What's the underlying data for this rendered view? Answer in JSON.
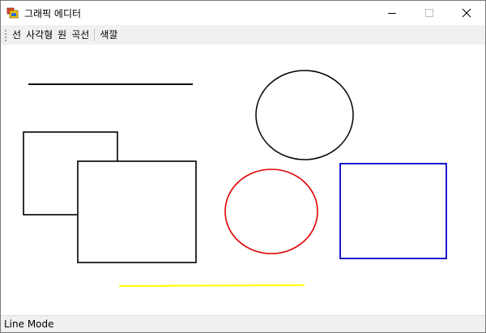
{
  "window": {
    "title": "그래픽 에디터",
    "app_icon": "form-icon",
    "controls": {
      "minimize": "minimize-icon",
      "maximize": "maximize-icon",
      "close": "close-icon"
    }
  },
  "toolbar": {
    "items": [
      "선",
      "사각형",
      "원",
      "곡선",
      "색깔"
    ]
  },
  "canvas": {
    "colors": {
      "black": "#000000",
      "red": "#e00000",
      "blue": "#0000c8",
      "yellow": "#ffff00"
    },
    "shapes": [
      "black line",
      "black ellipse",
      "black rectangle",
      "black rectangle",
      "red ellipse",
      "blue rectangle",
      "yellow line"
    ]
  },
  "statusbar": {
    "text": "Line Mode"
  }
}
